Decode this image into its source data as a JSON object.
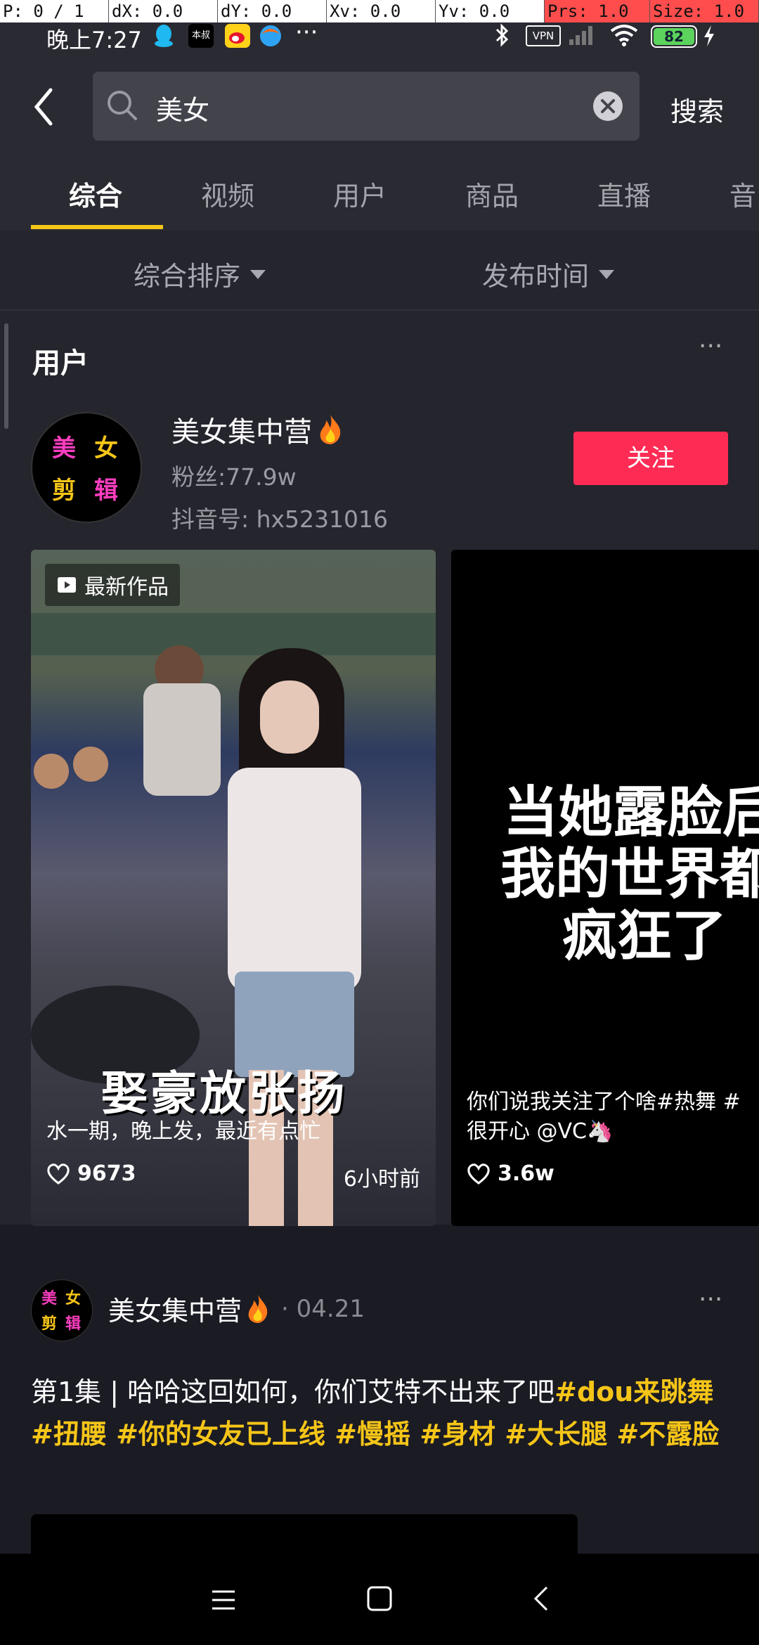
{
  "debug": {
    "p": "P: 0 / 1",
    "dx": "dX: 0.0",
    "dy": "dY: 0.0",
    "xv": "Xv: 0.0",
    "yv": "Yv: 0.0",
    "prs": "Prs: 1.0",
    "size": "Size: 1.0"
  },
  "status_bar": {
    "time": "晚上7:27",
    "app_badge_text": "本叔",
    "more": "···",
    "vpn": "VPN",
    "battery": "82"
  },
  "search": {
    "query": "美女",
    "submit_label": "搜索"
  },
  "tabs": [
    {
      "label": "综合"
    },
    {
      "label": "视频"
    },
    {
      "label": "用户"
    },
    {
      "label": "商品"
    },
    {
      "label": "直播"
    },
    {
      "label": "音"
    }
  ],
  "filters": {
    "sort": "综合排序",
    "time": "发布时间"
  },
  "users_section": {
    "title": "用户",
    "more": "···",
    "user": {
      "name": "美女集中营",
      "fans": "粉丝:77.9w",
      "douyin_id": "抖音号: hx5231016",
      "follow_label": "关注",
      "avatar_text": [
        "美",
        "女",
        "剪",
        "辑"
      ]
    }
  },
  "videos": [
    {
      "badge": "最新作品",
      "overlay_title": "娶豪放张扬",
      "caption": "水一期，晚上发，最近有点忙",
      "likes": "9673",
      "time": "6小时前"
    },
    {
      "overlay_lines": [
        "当她露脸后",
        "我的世界都",
        "疯狂了"
      ],
      "caption_line1": "你们说我关注了个啥#热舞 #",
      "caption_line2": "很开心 @VC🦄",
      "likes": "3.6w"
    }
  ],
  "post": {
    "author": "美女集中营",
    "date": "· 04.21",
    "more": "···",
    "text_plain": "第1集 | 哈哈这回如何，你们艾特不出来了吧",
    "hashtags": "#dou来跳舞 #扭腰 #你的女友已上线 #慢摇 #身材 #大长腿 #不露脸"
  },
  "colors": {
    "accent": "#fe2c55",
    "tab_indicator": "#f5c518",
    "hashtag": "#f5c518",
    "background": "#1b1b24"
  }
}
